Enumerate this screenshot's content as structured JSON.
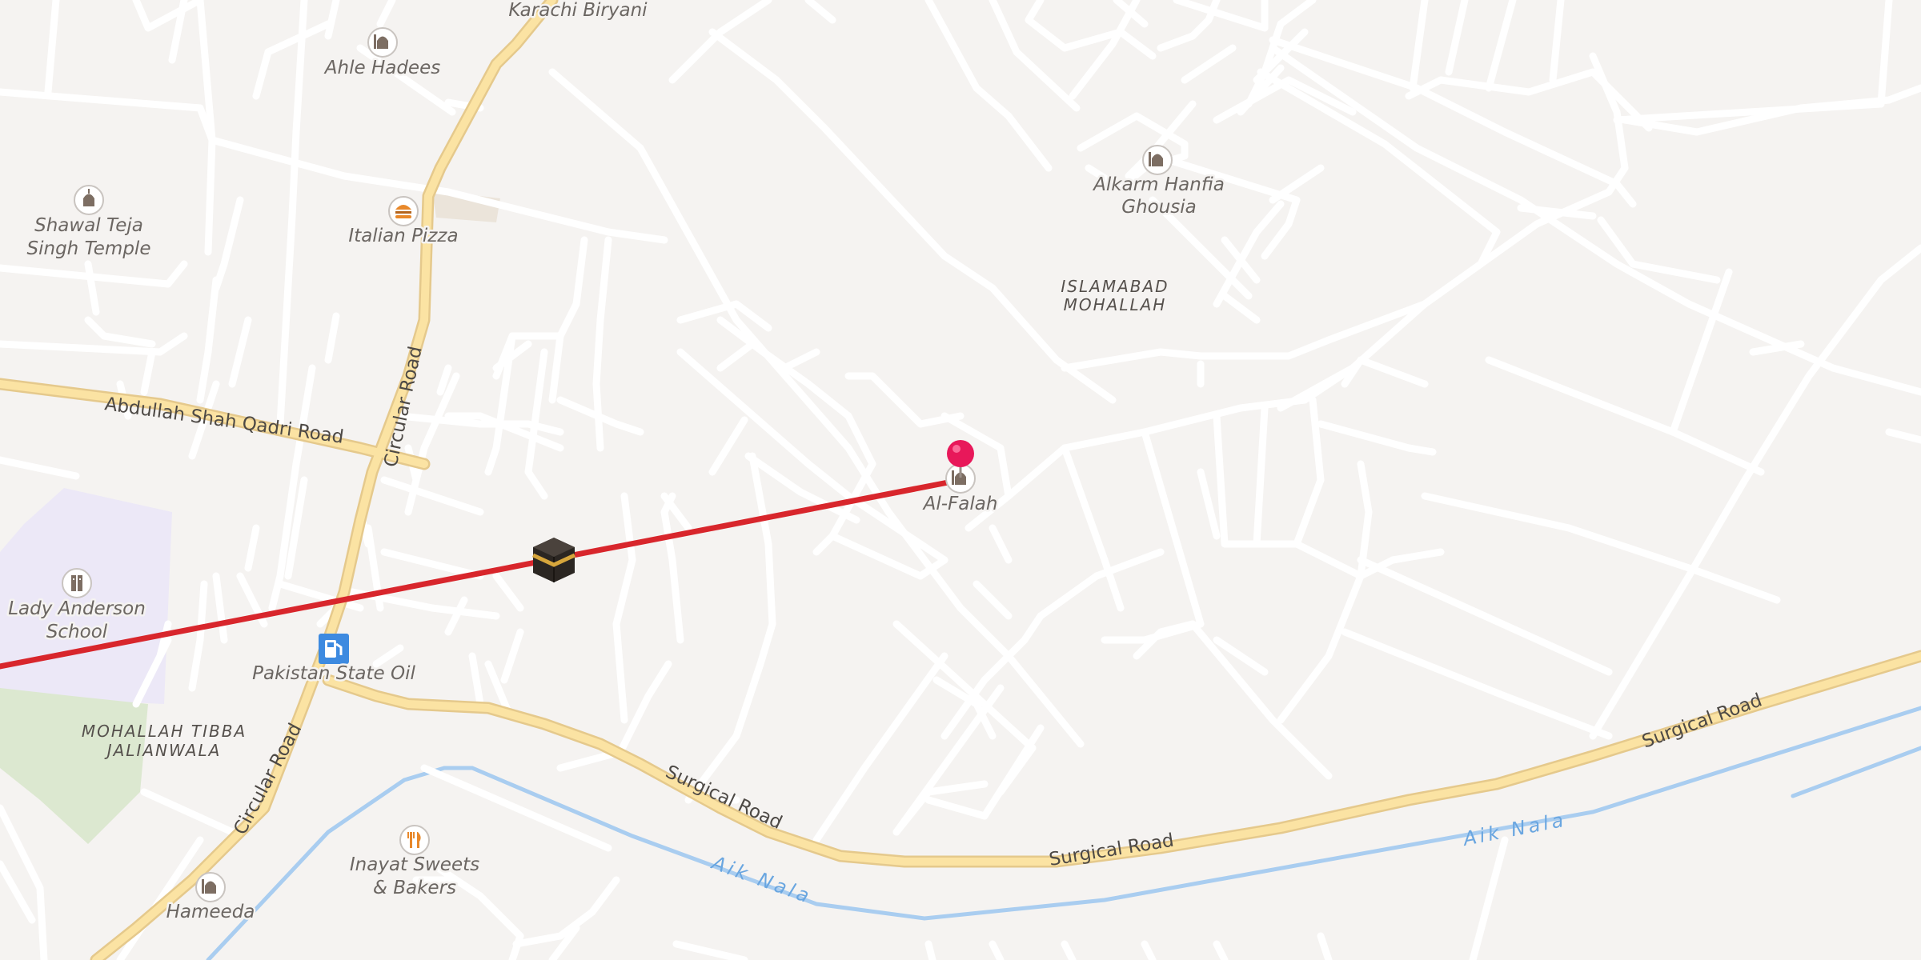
{
  "places": {
    "karachi_biryani": "Karachi Biryani",
    "ahle_hadees": "Ahle Hadees",
    "shawal_teja_line1": "Shawal Teja",
    "shawal_teja_line2": "Singh Temple",
    "italian_pizza": "Italian Pizza",
    "alkarm_line1": "Alkarm Hanfia",
    "alkarm_line2": "Ghousia",
    "islamabad_line1": "ISLAMABAD",
    "islamabad_line2": "MOHALLAH",
    "al_falah": "Al-Falah",
    "lady_anderson_line1": "Lady Anderson",
    "lady_anderson_line2": "School",
    "pakistan_state_oil": "Pakistan State Oil",
    "tibba_line1": "MOHALLAH TIBBA",
    "tibba_line2": "JALIANWALA",
    "inayat_line1": "Inayat Sweets",
    "inayat_line2": "& Bakers",
    "hameeda": "Hameeda"
  },
  "roads": {
    "abdullah_shah_qadri": "Abdullah Shah Qadri Road",
    "circular_upper": "Circular Road",
    "circular_lower": "Circular Road",
    "surgical_1": "Surgical Road",
    "surgical_2": "Surgical Road",
    "surgical_3": "Surgical Road"
  },
  "water": {
    "aik_nala_1": "Aik Nala",
    "aik_nala_2": "Aik Nala"
  },
  "colors": {
    "background": "#f5f3f1",
    "minor_road": "#ffffff",
    "major_road": "#fbe3a3",
    "water": "#a9cdf0",
    "qibla_line": "#d8262c",
    "pin": "#e8185a",
    "school_area": "#ece8f7",
    "park_area": "#dce8d0"
  },
  "icons": {
    "pin": "location-pin-icon",
    "kaaba": "kaaba-icon",
    "mosque": "mosque-icon",
    "temple": "temple-icon",
    "restaurant": "burger-icon",
    "school": "school-icon",
    "fuel": "fuel-station-icon",
    "food": "fork-knife-icon"
  }
}
